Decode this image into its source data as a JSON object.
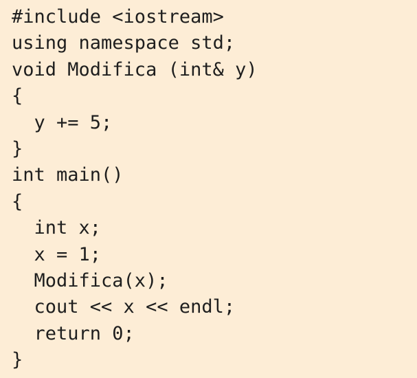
{
  "code": {
    "lines": [
      "#include <iostream>",
      "using namespace std;",
      "void Modifica (int& y)",
      "{",
      "  y += 5;",
      "}",
      "int main()",
      "{",
      "  int x;",
      "  x = 1;",
      "  Modifica(x);",
      "  cout << x << endl;",
      "  return 0;",
      "}"
    ]
  },
  "colors": {
    "background": "#FDEDD6",
    "text": "#1E1E1E"
  }
}
